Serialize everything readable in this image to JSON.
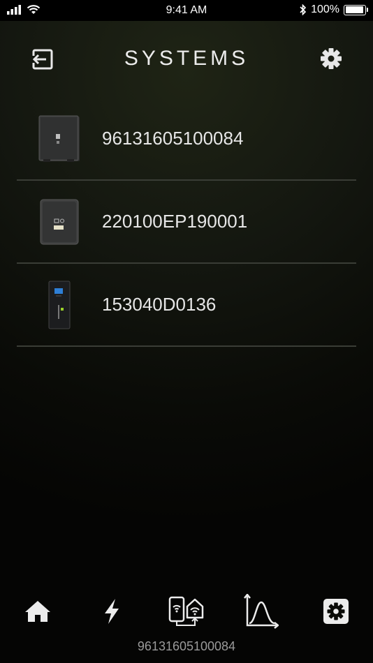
{
  "status_bar": {
    "time": "9:41 AM",
    "battery": "100%"
  },
  "header": {
    "title": "SYSTEMS",
    "logout_icon": "logout-icon",
    "settings_icon": "gear-icon"
  },
  "systems": [
    {
      "serial": "96131605100084",
      "device": "inverter-dark-box"
    },
    {
      "serial": "220100EP190001",
      "device": "inverter-hyo-box"
    },
    {
      "serial": "153040D0136",
      "device": "battery-tower"
    }
  ],
  "tabs": [
    {
      "icon": "home-icon"
    },
    {
      "icon": "lightning-icon"
    },
    {
      "icon": "connectivity-icon"
    },
    {
      "icon": "chart-curve-icon"
    },
    {
      "icon": "gear-icon"
    }
  ],
  "footer": {
    "active_serial": "96131605100084"
  }
}
